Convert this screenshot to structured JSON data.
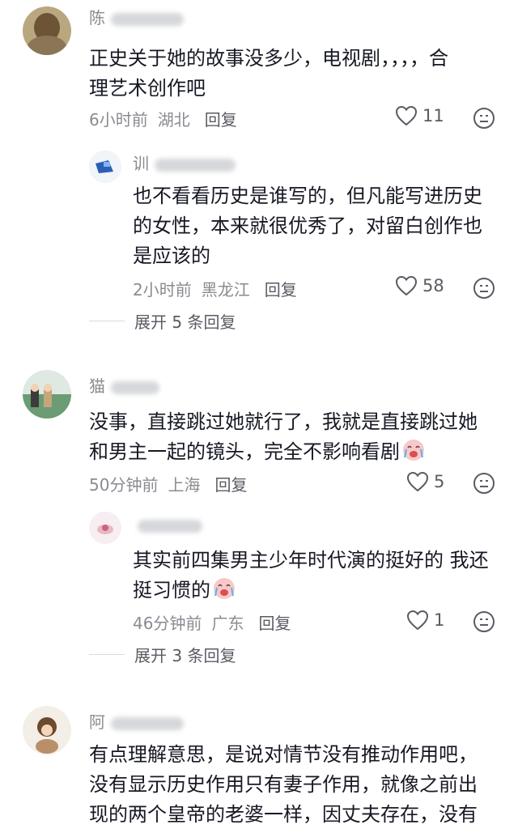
{
  "comments": [
    {
      "username": "陈",
      "text": [
        "正史关于她的故事没多少，电视剧，，，，合",
        "理艺术创作吧"
      ],
      "time": "6小时前",
      "location": "湖北",
      "reply_label": "回复",
      "likes": "11",
      "replies": [
        {
          "username": "训",
          "text": [
            "也不看看历史是谁写的，但凡能写进历史",
            "的女性，本来就很优秀了，对留白创作也",
            "是应该的"
          ],
          "time": "2小时前",
          "location": "黑龙江",
          "reply_label": "回复",
          "likes": "58"
        }
      ],
      "expand_label": "展开 5 条回复"
    },
    {
      "username": "猫",
      "text": [
        "没事，直接跳过她就行了，我就是直接跳过她",
        "和男主一起的镜头，完全不影响看剧"
      ],
      "time": "50分钟前",
      "location": "上海",
      "reply_label": "回复",
      "likes": "5",
      "replies": [
        {
          "username": "",
          "text": [
            "其实前四集男主少年时代演的挺好的 我还",
            "挺习惯的"
          ],
          "time": "46分钟前",
          "location": "广东",
          "reply_label": "回复",
          "likes": "1"
        }
      ],
      "expand_label": "展开 3 条回复"
    },
    {
      "username": "阿",
      "text": [
        "有点理解意思，是说对情节没有推动作用吧，",
        "没有显示历史作用只有妻子作用，就像之前出",
        "现的两个皇帝的老婆一样，因丈夫存在，没有"
      ]
    }
  ],
  "colors": {
    "text": "#161823",
    "meta": "#8a8b91",
    "action": "#5a5b63"
  },
  "icons": {
    "like": "heart-outline-icon",
    "dislike": "sad-face-icon",
    "emoji": "crying-laugh-emoji"
  }
}
